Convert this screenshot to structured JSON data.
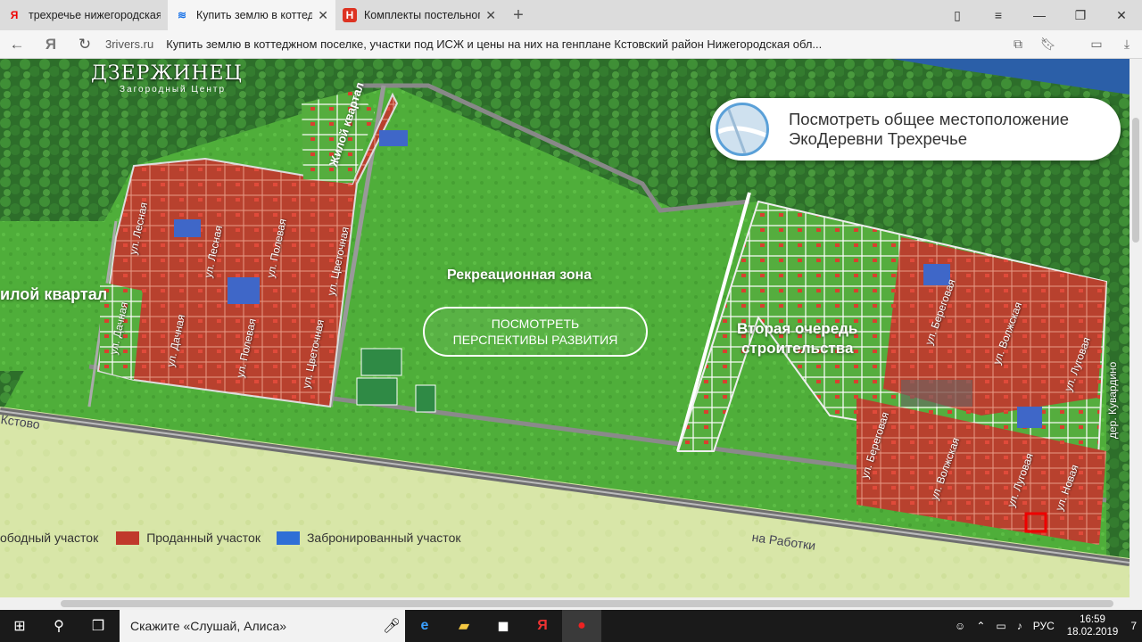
{
  "browser": {
    "tabs": [
      {
        "favicon": "Я",
        "title": "трехречье нижегородская",
        "active": false
      },
      {
        "favicon": "≋",
        "title": "Купить землю в коттеджн",
        "active": true
      },
      {
        "favicon": "Н",
        "title": "Комплекты постельного б",
        "active": false
      }
    ],
    "url_domain": "3rivers.ru",
    "page_title": "Купить землю в коттеджном поселке, участки под ИСЖ и цены на них на генплане Кстовский район Нижегородская обл...",
    "yandex_logo": "Я"
  },
  "map": {
    "logo_title": "ДЗЕРЖИНЕЦ",
    "logo_sub": "Загородный Центр",
    "zone_residential": "Жилой квартал",
    "zone_residential_partial": "илой квартал",
    "zone_recreation": "Рекреационная зона",
    "perspective_line1": "ПОСМОТРЕТЬ",
    "perspective_line2": "ПЕРСПЕКТИВЫ РАЗВИТИЯ",
    "second_stage_line1": "Вторая очередь",
    "second_stage_line2": "строительства",
    "location_line1": "Посмотреть общее местоположение",
    "location_line2": "ЭкоДеревни Трехречье",
    "road_kstovo": "Кстово",
    "road_raboty": "на Работки",
    "village": "дер. Кувардино",
    "streets": {
      "lesnaya1": "ул. Лесная",
      "lesnaya2": "ул. Лесная",
      "polevaya1": "ул. Полевая",
      "polevaya2": "ул. Полевая",
      "cvetochnaya1": "ул. Цветочная",
      "cvetochnaya2": "ул. Цветочная",
      "dachnaya1": "ул. Дачная",
      "dachnaya2": "ул. Дачная",
      "beregovaya1": "ул. Береговая",
      "beregovaya2": "ул. Береговая",
      "volzhskaya1": "ул. Волжская",
      "volzhskaya2": "ул. Волжская",
      "lugovaya1": "ул. Луговая",
      "lugovaya2": "ул. Луговая",
      "novaya": "ул. Новая"
    },
    "legend": {
      "free": "ободный участок",
      "sold": "Проданный участок",
      "reserved": "Забронированный участок"
    },
    "colors": {
      "sold": "#c0392b",
      "reserved": "#2f6fd6",
      "free": "#ffffff"
    }
  },
  "taskbar": {
    "search_text": "Скажите «Слушай, Алиса»",
    "lang": "РУС",
    "time": "16:59",
    "date": "18.02.2019",
    "notifications": "7"
  }
}
